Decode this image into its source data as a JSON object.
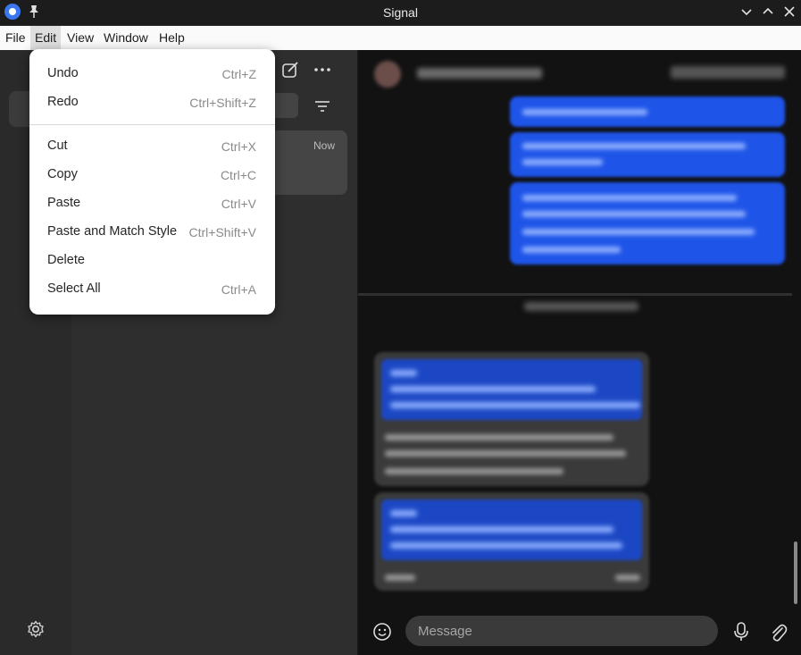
{
  "window": {
    "title": "Signal"
  },
  "menubar": {
    "items": [
      "File",
      "Edit",
      "View",
      "Window",
      "Help"
    ]
  },
  "edit_menu": {
    "items": [
      {
        "label": "Undo",
        "shortcut": "Ctrl+Z"
      },
      {
        "label": "Redo",
        "shortcut": "Ctrl+Shift+Z"
      },
      {
        "label": "Cut",
        "shortcut": "Ctrl+X"
      },
      {
        "label": "Copy",
        "shortcut": "Ctrl+C"
      },
      {
        "label": "Paste",
        "shortcut": "Ctrl+V"
      },
      {
        "label": "Paste and Match Style",
        "shortcut": "Ctrl+Shift+V"
      },
      {
        "label": "Delete",
        "shortcut": ""
      },
      {
        "label": "Select All",
        "shortcut": "Ctrl+A"
      }
    ]
  },
  "chat_list": {
    "items": [
      {
        "time": "Now"
      }
    ]
  },
  "composer": {
    "placeholder": "Message"
  },
  "colors": {
    "accent": "#3a76f0",
    "outgoing_bubble": "#1e54e8",
    "menu_bg": "#ffffff"
  },
  "icons": [
    "app-icon",
    "pin-icon",
    "chevron-down-icon",
    "chevron-up-icon",
    "close-icon",
    "compose-icon",
    "more-icon",
    "filter-icon",
    "gear-icon",
    "emoji-icon",
    "mic-icon",
    "attach-icon"
  ]
}
